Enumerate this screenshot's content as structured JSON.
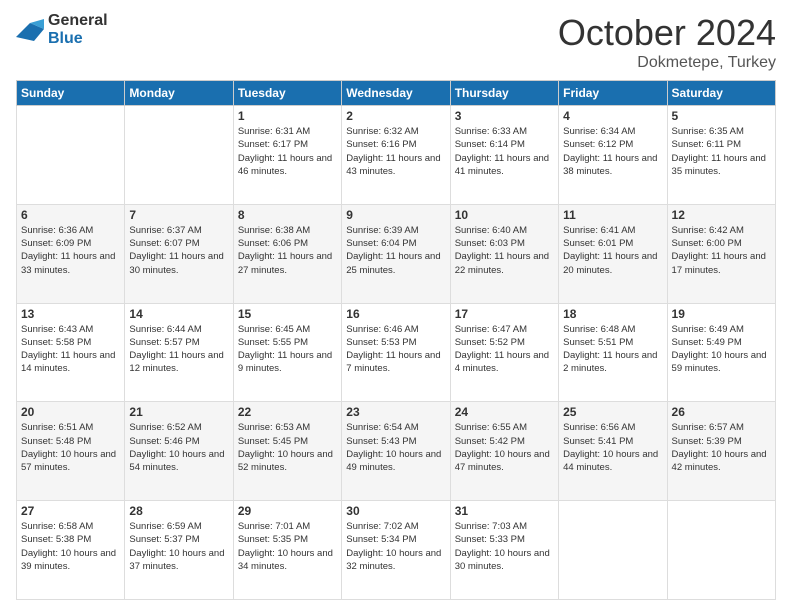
{
  "header": {
    "logo_general": "General",
    "logo_blue": "Blue",
    "month_year": "October 2024",
    "location": "Dokmetepe, Turkey"
  },
  "weekdays": [
    "Sunday",
    "Monday",
    "Tuesday",
    "Wednesday",
    "Thursday",
    "Friday",
    "Saturday"
  ],
  "weeks": [
    [
      {
        "day": "",
        "sunrise": "",
        "sunset": "",
        "daylight": ""
      },
      {
        "day": "",
        "sunrise": "",
        "sunset": "",
        "daylight": ""
      },
      {
        "day": "1",
        "sunrise": "Sunrise: 6:31 AM",
        "sunset": "Sunset: 6:17 PM",
        "daylight": "Daylight: 11 hours and 46 minutes."
      },
      {
        "day": "2",
        "sunrise": "Sunrise: 6:32 AM",
        "sunset": "Sunset: 6:16 PM",
        "daylight": "Daylight: 11 hours and 43 minutes."
      },
      {
        "day": "3",
        "sunrise": "Sunrise: 6:33 AM",
        "sunset": "Sunset: 6:14 PM",
        "daylight": "Daylight: 11 hours and 41 minutes."
      },
      {
        "day": "4",
        "sunrise": "Sunrise: 6:34 AM",
        "sunset": "Sunset: 6:12 PM",
        "daylight": "Daylight: 11 hours and 38 minutes."
      },
      {
        "day": "5",
        "sunrise": "Sunrise: 6:35 AM",
        "sunset": "Sunset: 6:11 PM",
        "daylight": "Daylight: 11 hours and 35 minutes."
      }
    ],
    [
      {
        "day": "6",
        "sunrise": "Sunrise: 6:36 AM",
        "sunset": "Sunset: 6:09 PM",
        "daylight": "Daylight: 11 hours and 33 minutes."
      },
      {
        "day": "7",
        "sunrise": "Sunrise: 6:37 AM",
        "sunset": "Sunset: 6:07 PM",
        "daylight": "Daylight: 11 hours and 30 minutes."
      },
      {
        "day": "8",
        "sunrise": "Sunrise: 6:38 AM",
        "sunset": "Sunset: 6:06 PM",
        "daylight": "Daylight: 11 hours and 27 minutes."
      },
      {
        "day": "9",
        "sunrise": "Sunrise: 6:39 AM",
        "sunset": "Sunset: 6:04 PM",
        "daylight": "Daylight: 11 hours and 25 minutes."
      },
      {
        "day": "10",
        "sunrise": "Sunrise: 6:40 AM",
        "sunset": "Sunset: 6:03 PM",
        "daylight": "Daylight: 11 hours and 22 minutes."
      },
      {
        "day": "11",
        "sunrise": "Sunrise: 6:41 AM",
        "sunset": "Sunset: 6:01 PM",
        "daylight": "Daylight: 11 hours and 20 minutes."
      },
      {
        "day": "12",
        "sunrise": "Sunrise: 6:42 AM",
        "sunset": "Sunset: 6:00 PM",
        "daylight": "Daylight: 11 hours and 17 minutes."
      }
    ],
    [
      {
        "day": "13",
        "sunrise": "Sunrise: 6:43 AM",
        "sunset": "Sunset: 5:58 PM",
        "daylight": "Daylight: 11 hours and 14 minutes."
      },
      {
        "day": "14",
        "sunrise": "Sunrise: 6:44 AM",
        "sunset": "Sunset: 5:57 PM",
        "daylight": "Daylight: 11 hours and 12 minutes."
      },
      {
        "day": "15",
        "sunrise": "Sunrise: 6:45 AM",
        "sunset": "Sunset: 5:55 PM",
        "daylight": "Daylight: 11 hours and 9 minutes."
      },
      {
        "day": "16",
        "sunrise": "Sunrise: 6:46 AM",
        "sunset": "Sunset: 5:53 PM",
        "daylight": "Daylight: 11 hours and 7 minutes."
      },
      {
        "day": "17",
        "sunrise": "Sunrise: 6:47 AM",
        "sunset": "Sunset: 5:52 PM",
        "daylight": "Daylight: 11 hours and 4 minutes."
      },
      {
        "day": "18",
        "sunrise": "Sunrise: 6:48 AM",
        "sunset": "Sunset: 5:51 PM",
        "daylight": "Daylight: 11 hours and 2 minutes."
      },
      {
        "day": "19",
        "sunrise": "Sunrise: 6:49 AM",
        "sunset": "Sunset: 5:49 PM",
        "daylight": "Daylight: 10 hours and 59 minutes."
      }
    ],
    [
      {
        "day": "20",
        "sunrise": "Sunrise: 6:51 AM",
        "sunset": "Sunset: 5:48 PM",
        "daylight": "Daylight: 10 hours and 57 minutes."
      },
      {
        "day": "21",
        "sunrise": "Sunrise: 6:52 AM",
        "sunset": "Sunset: 5:46 PM",
        "daylight": "Daylight: 10 hours and 54 minutes."
      },
      {
        "day": "22",
        "sunrise": "Sunrise: 6:53 AM",
        "sunset": "Sunset: 5:45 PM",
        "daylight": "Daylight: 10 hours and 52 minutes."
      },
      {
        "day": "23",
        "sunrise": "Sunrise: 6:54 AM",
        "sunset": "Sunset: 5:43 PM",
        "daylight": "Daylight: 10 hours and 49 minutes."
      },
      {
        "day": "24",
        "sunrise": "Sunrise: 6:55 AM",
        "sunset": "Sunset: 5:42 PM",
        "daylight": "Daylight: 10 hours and 47 minutes."
      },
      {
        "day": "25",
        "sunrise": "Sunrise: 6:56 AM",
        "sunset": "Sunset: 5:41 PM",
        "daylight": "Daylight: 10 hours and 44 minutes."
      },
      {
        "day": "26",
        "sunrise": "Sunrise: 6:57 AM",
        "sunset": "Sunset: 5:39 PM",
        "daylight": "Daylight: 10 hours and 42 minutes."
      }
    ],
    [
      {
        "day": "27",
        "sunrise": "Sunrise: 6:58 AM",
        "sunset": "Sunset: 5:38 PM",
        "daylight": "Daylight: 10 hours and 39 minutes."
      },
      {
        "day": "28",
        "sunrise": "Sunrise: 6:59 AM",
        "sunset": "Sunset: 5:37 PM",
        "daylight": "Daylight: 10 hours and 37 minutes."
      },
      {
        "day": "29",
        "sunrise": "Sunrise: 7:01 AM",
        "sunset": "Sunset: 5:35 PM",
        "daylight": "Daylight: 10 hours and 34 minutes."
      },
      {
        "day": "30",
        "sunrise": "Sunrise: 7:02 AM",
        "sunset": "Sunset: 5:34 PM",
        "daylight": "Daylight: 10 hours and 32 minutes."
      },
      {
        "day": "31",
        "sunrise": "Sunrise: 7:03 AM",
        "sunset": "Sunset: 5:33 PM",
        "daylight": "Daylight: 10 hours and 30 minutes."
      },
      {
        "day": "",
        "sunrise": "",
        "sunset": "",
        "daylight": ""
      },
      {
        "day": "",
        "sunrise": "",
        "sunset": "",
        "daylight": ""
      }
    ]
  ]
}
